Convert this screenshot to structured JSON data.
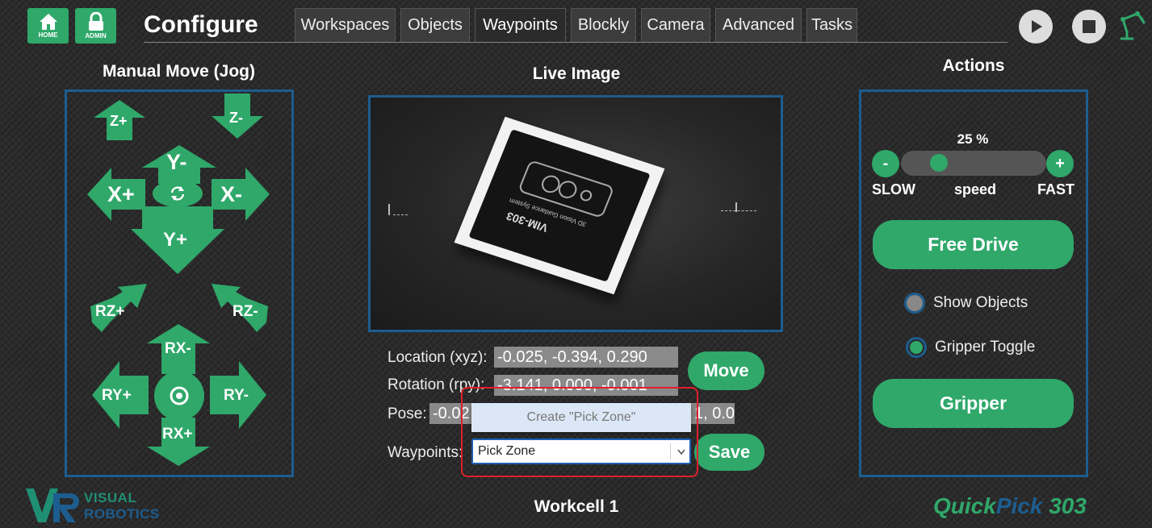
{
  "header": {
    "home_label": "HOME",
    "admin_label": "ADMIN",
    "title": "Configure",
    "tabs": [
      {
        "label": "Workspaces"
      },
      {
        "label": "Objects"
      },
      {
        "label": "Waypoints",
        "active": true
      },
      {
        "label": "Blockly"
      },
      {
        "label": "Camera"
      },
      {
        "label": "Advanced"
      },
      {
        "label": "Tasks"
      }
    ],
    "icons": [
      "home-icon",
      "lock-icon",
      "play-icon",
      "stop-icon",
      "robot-arm-icon"
    ]
  },
  "jog": {
    "heading": "Manual Move (Jog)",
    "z_plus": "Z+",
    "z_minus": "Z-",
    "y_minus": "Y-",
    "y_plus": "Y+",
    "x_plus": "X+",
    "x_minus": "X-",
    "rz_plus": "RZ+",
    "rz_minus": "RZ-",
    "rx_minus": "RX-",
    "rx_plus": "RX+",
    "ry_plus": "RY+",
    "ry_minus": "RY-"
  },
  "live": {
    "heading": "Live Image",
    "location_label": "Location (xyz):",
    "location_value": "-0.025, -0.394, 0.290",
    "rotation_label": "Rotation (rpy):",
    "rotation_value": "-3.141, 0.000, -0.001",
    "pose_label": "Pose:",
    "pose_value_left": "-0.02",
    "pose_value_right": "1, 0.0",
    "move_button": "Move",
    "waypoints_label": "Waypoints:",
    "waypoint_input_value": "Pick Zone",
    "dropdown_suggestion": "Create \"Pick Zone\"",
    "save_button": "Save",
    "box_brand": "VIM-303",
    "box_subtitle": "3D Vision Guidance System",
    "workcell": "Workcell 1"
  },
  "actions": {
    "heading": "Actions",
    "speed_percent": "25 %",
    "speed_value": 25,
    "minus": "-",
    "plus": "+",
    "slow": "SLOW",
    "speed": "speed",
    "fast": "FAST",
    "free_drive": "Free Drive",
    "show_objects": "Show Objects",
    "gripper_toggle": "Gripper Toggle",
    "gripper": "Gripper"
  },
  "footer": {
    "brand_line1": "VISUAL",
    "brand_line2": "ROBOTICS",
    "product_part1": "Quick",
    "product_part2": "Pick",
    "product_part3": " 303"
  },
  "colors": {
    "accent_green": "#2fa86a",
    "panel_border": "#1d5d8f",
    "highlight_red": "#e0202a"
  }
}
